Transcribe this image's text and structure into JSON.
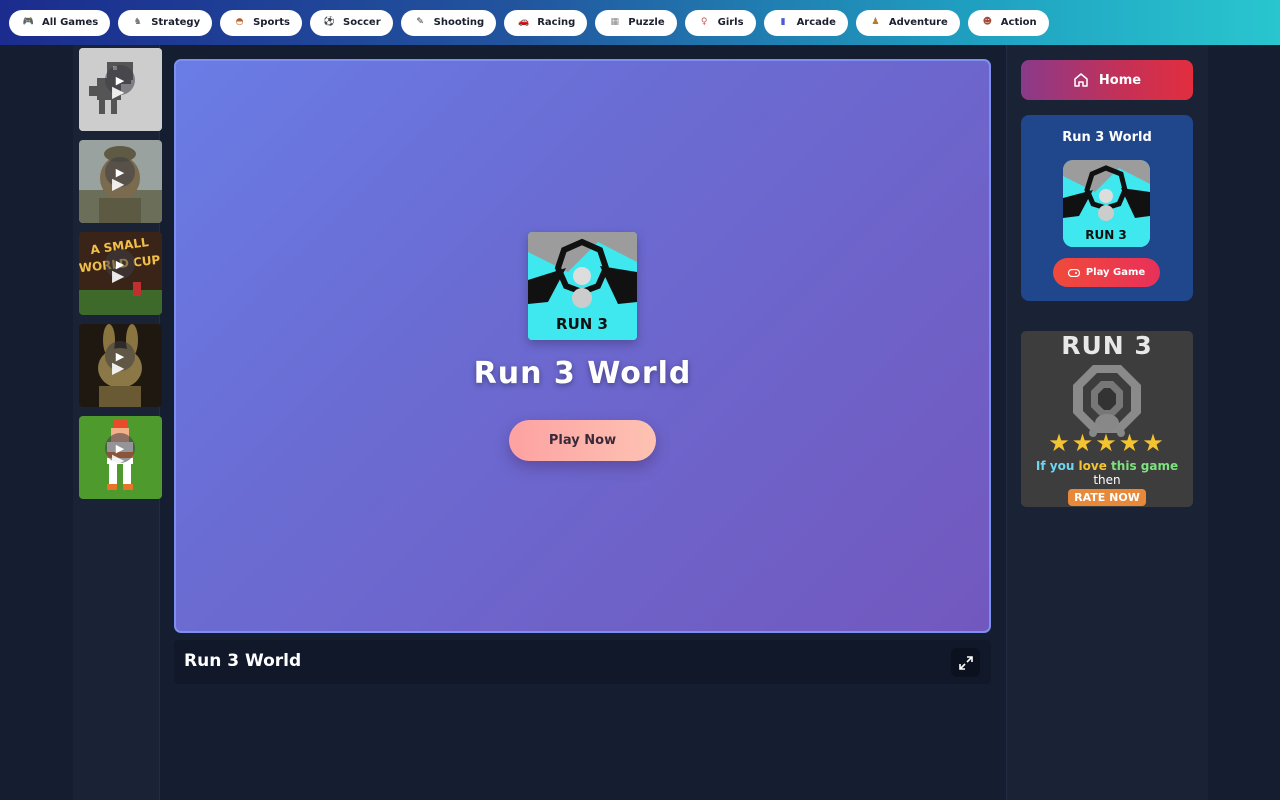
{
  "nav": {
    "categories": [
      {
        "label": "All Games",
        "icon": "gamepad-icon"
      },
      {
        "label": "Strategy",
        "icon": "strategy-icon"
      },
      {
        "label": "Sports",
        "icon": "sports-icon"
      },
      {
        "label": "Soccer",
        "icon": "soccer-ball-icon"
      },
      {
        "label": "Shooting",
        "icon": "gun-icon"
      },
      {
        "label": "Racing",
        "icon": "race-car-icon"
      },
      {
        "label": "Puzzle",
        "icon": "puzzle-icon"
      },
      {
        "label": "Girls",
        "icon": "girl-icon"
      },
      {
        "label": "Arcade",
        "icon": "arcade-icon"
      },
      {
        "label": "Adventure",
        "icon": "adventure-icon"
      },
      {
        "label": "Action",
        "icon": "action-icon"
      }
    ]
  },
  "sidebar": {
    "thumbs": [
      {
        "name": "dino-game-thumb"
      },
      {
        "name": "soldier-game-thumb",
        "color": "#6b6f5a"
      },
      {
        "name": "small-world-cup-thumb",
        "text": "A SMALL WORLD CUP",
        "color": "#4a2a1c"
      },
      {
        "name": "bunny-animatronic-thumb",
        "color": "#3b2f18"
      },
      {
        "name": "pixel-player-thumb",
        "color": "#4f9a2c"
      }
    ]
  },
  "game": {
    "title": "Run 3 World",
    "icon_text": "RUN 3",
    "play_label": "Play Now",
    "info_title": "Run 3 World"
  },
  "right": {
    "home_label": "Home",
    "card_title": "Run 3 World",
    "card_icon_text": "RUN 3",
    "play_game_label": "Play Game",
    "promo": {
      "title": "RUN 3",
      "stars": "★★★★★",
      "line1_parts": [
        "If you ",
        "love ",
        "this game"
      ],
      "line2": "then",
      "rate_label": "RATE NOW"
    }
  },
  "colors": {
    "accent_cyan": "#33e0e8",
    "star": "#f4c430"
  }
}
